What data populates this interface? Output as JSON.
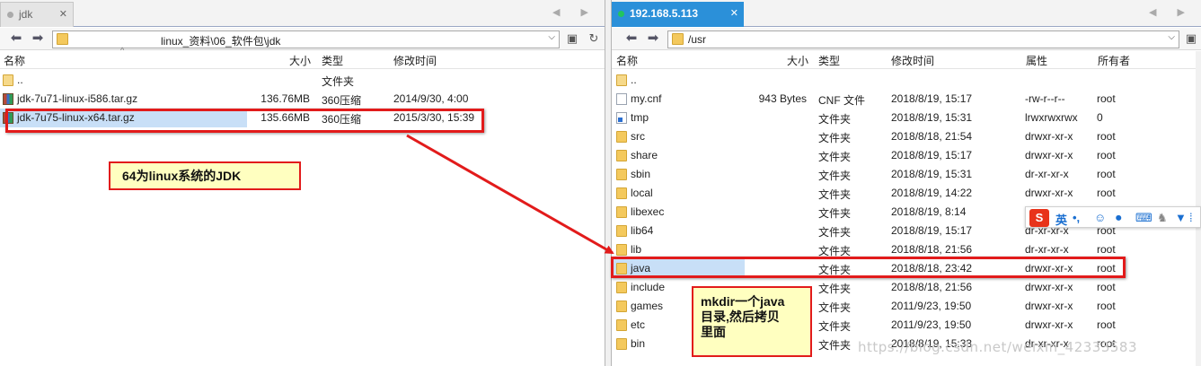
{
  "left": {
    "tab": {
      "label": "jdk",
      "close": "✕"
    },
    "tab_arrows": "◀ ▶",
    "nav": {
      "back": "⬅",
      "forward": "➡"
    },
    "path": "linux_资料\\06_软件包\\jdk",
    "path_chevron": "⌵",
    "columns": {
      "name": "名称",
      "size": "大小",
      "type": "类型",
      "mtime": "修改时间"
    },
    "sort_mark": "^",
    "rows": [
      {
        "icon": "parent-folder-icon",
        "name": "..",
        "size": "",
        "type": "文件夹",
        "mtime": ""
      },
      {
        "icon": "archive-icon",
        "name": "jdk-7u71-linux-i586.tar.gz",
        "size": "136.76MB",
        "type": "360压缩",
        "mtime": "2014/9/30, 4:00"
      },
      {
        "icon": "archive-icon",
        "name": "jdk-7u75-linux-x64.tar.gz",
        "size": "135.66MB",
        "type": "360压缩",
        "mtime": "2015/3/30, 15:39"
      }
    ]
  },
  "right": {
    "tab": {
      "label": "192.168.5.113",
      "close": "✕"
    },
    "tab_arrows": "◀ ▶",
    "nav": {
      "back": "⬅",
      "forward": "➡"
    },
    "path": "/usr",
    "path_chevron": "⌵",
    "columns": {
      "name": "名称",
      "size": "大小",
      "type": "类型",
      "mtime": "修改时间",
      "attr": "属性",
      "owner": "所有者"
    },
    "rows": [
      {
        "icon": "parent-folder-icon",
        "name": "..",
        "size": "",
        "type": "",
        "mtime": "",
        "attr": "",
        "owner": ""
      },
      {
        "icon": "file-icon",
        "name": "my.cnf",
        "size": "943 Bytes",
        "type": "CNF 文件",
        "mtime": "2018/8/19, 15:17",
        "attr": "-rw-r--r--",
        "owner": "root"
      },
      {
        "icon": "symlink-icon",
        "name": "tmp",
        "size": "",
        "type": "文件夹",
        "mtime": "2018/8/19, 15:31",
        "attr": "lrwxrwxrwx",
        "owner": "0"
      },
      {
        "icon": "folder-icon",
        "name": "src",
        "size": "",
        "type": "文件夹",
        "mtime": "2018/8/18, 21:54",
        "attr": "drwxr-xr-x",
        "owner": "root"
      },
      {
        "icon": "folder-icon",
        "name": "share",
        "size": "",
        "type": "文件夹",
        "mtime": "2018/8/19, 15:17",
        "attr": "drwxr-xr-x",
        "owner": "root"
      },
      {
        "icon": "folder-icon",
        "name": "sbin",
        "size": "",
        "type": "文件夹",
        "mtime": "2018/8/19, 15:31",
        "attr": "dr-xr-xr-x",
        "owner": "root"
      },
      {
        "icon": "folder-icon",
        "name": "local",
        "size": "",
        "type": "文件夹",
        "mtime": "2018/8/19, 14:22",
        "attr": "drwxr-xr-x",
        "owner": "root"
      },
      {
        "icon": "folder-icon",
        "name": "libexec",
        "size": "",
        "type": "文件夹",
        "mtime": "2018/8/19, 8:14",
        "attr": "",
        "owner": ""
      },
      {
        "icon": "folder-icon",
        "name": "lib64",
        "size": "",
        "type": "文件夹",
        "mtime": "2018/8/19, 15:17",
        "attr": "dr-xr-xr-x",
        "owner": "root"
      },
      {
        "icon": "folder-icon",
        "name": "lib",
        "size": "",
        "type": "文件夹",
        "mtime": "2018/8/18, 21:56",
        "attr": "dr-xr-xr-x",
        "owner": "root"
      },
      {
        "icon": "folder-icon",
        "name": "java",
        "size": "",
        "type": "文件夹",
        "mtime": "2018/8/18, 23:42",
        "attr": "drwxr-xr-x",
        "owner": "root"
      },
      {
        "icon": "folder-icon",
        "name": "include",
        "size": "",
        "type": "文件夹",
        "mtime": "2018/8/18, 21:56",
        "attr": "drwxr-xr-x",
        "owner": "root"
      },
      {
        "icon": "folder-icon",
        "name": "games",
        "size": "",
        "type": "文件夹",
        "mtime": "2011/9/23, 19:50",
        "attr": "drwxr-xr-x",
        "owner": "root"
      },
      {
        "icon": "folder-icon",
        "name": "etc",
        "size": "",
        "type": "文件夹",
        "mtime": "2011/9/23, 19:50",
        "attr": "drwxr-xr-x",
        "owner": "root"
      },
      {
        "icon": "folder-icon",
        "name": "bin",
        "size": "",
        "type": "文件夹",
        "mtime": "2018/8/19, 15:33",
        "attr": "dr-xr-xr-x",
        "owner": "root"
      }
    ]
  },
  "annotations": {
    "note1": "64为linux系统的JDK",
    "note2_line1": "mkdir一个java",
    "note2_line2": "目录,然后拷贝",
    "note2_line3": "里面"
  },
  "ime": {
    "logo": "S",
    "lang": "英",
    "punct": "•,",
    "items": [
      "smile-icon",
      "mic-icon",
      "keyboard-icon",
      "user-icon",
      "shirt-icon",
      "grid-icon"
    ]
  },
  "watermark": "https://blog.csdn.net/weixin_42333583",
  "colors": {
    "annotation_red": "#e21b1b",
    "note_fill": "#ffffc0",
    "tab_active": "#2b90d9",
    "selection": "#c8dff7"
  }
}
